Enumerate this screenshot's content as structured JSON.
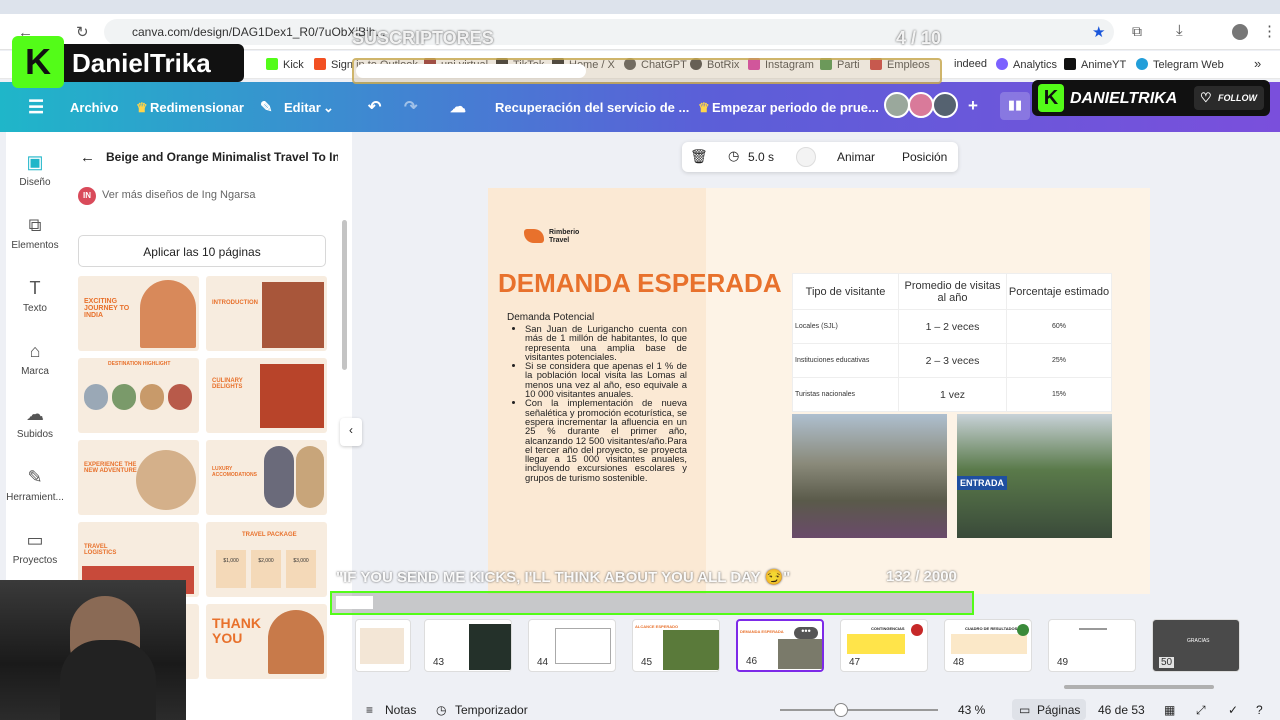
{
  "browser": {
    "url": "canva.com/design/DAG1Dex1_R0/7uObXiBjh...",
    "bookmarks": [
      "Kick",
      "Sign in to Outlook",
      "uni virtual",
      "TikTok",
      "Home / X",
      "ChatGPT",
      "BotRix",
      "Instagram",
      "Parti",
      "Empleos",
      "indeed",
      "Analytics",
      "AnimeYT",
      "Telegram Web"
    ],
    "bookmarks_more": "»"
  },
  "overlay": {
    "brand": "DanielTrika",
    "brand_right": "DANIELTRIKA",
    "follow": "FOLLOW",
    "subs_label": "SUSCRIPTORES",
    "subs_count": "4 / 10",
    "kicks_msg": "\"IF YOU SEND ME KICKS, I'LL THINK ABOUT YOU ALL DAY 😏\"",
    "kicks_count": "132 / 2000",
    "kicks_bar_label": "▮▮▮▮"
  },
  "header": {
    "menu_icon": "hamburger-icon",
    "file": "Archivo",
    "resize": "Redimensionar",
    "edit": "Editar",
    "title": "Recuperación del servicio de ...",
    "trial": "Empezar periodo de prue..."
  },
  "rail": [
    {
      "label": "Diseño",
      "icon": "design-icon"
    },
    {
      "label": "Elementos",
      "icon": "elements-icon"
    },
    {
      "label": "Texto",
      "icon": "text-icon"
    },
    {
      "label": "Marca",
      "icon": "brand-icon"
    },
    {
      "label": "Subidos",
      "icon": "uploads-icon"
    },
    {
      "label": "Herramient...",
      "icon": "tools-icon"
    },
    {
      "label": "Proyectos",
      "icon": "projects-icon"
    }
  ],
  "panel": {
    "title": "Beige and Orange Minimalist Travel To In...",
    "author_initials": "IN",
    "author": "Ver más diseños de Ing Ngarsa",
    "apply": "Aplicar las 10 páginas",
    "thumbs": [
      "EXCITING JOURNEY TO INDIA",
      "INTRODUCTION",
      "DESTINATION HIGHLIGHT",
      "CULINARY DELIGHTS",
      "EXPERIENCE THE NEW ADVENTURE",
      "LUXURY ACCOMODATIONS",
      "TRAVEL LOGISTICS",
      "TRAVEL PACKAGE",
      "",
      "THANK YOU"
    ],
    "package_prices": [
      "$1,000",
      "$2,000",
      "$3,000"
    ]
  },
  "toolbar": {
    "duration": "5.0 s",
    "animate": "Animar",
    "position": "Posición"
  },
  "slide": {
    "logo": "Rimberio Travel",
    "title": "DEMANDA ESPERADA",
    "subtitle": "Demanda Potencial",
    "bullets": [
      "San Juan de Lurigancho cuenta con más de 1 millón de habitantes, lo que representa una amplia base de visitantes potenciales.",
      "Si se considera que apenas el 1 % de la población local visita las Lomas al menos una vez al año, eso equivale a 10 000 visitantes anuales.",
      "Con la implementación de nueva señalética y promoción ecoturística, se espera incrementar la afluencia en un 25 % durante el primer año, alcanzando 12 500 visitantes/año.Para el tercer año del proyecto, se proyecta llegar a 15 000 visitantes anuales, incluyendo excursiones escolares y grupos de turismo sostenible."
    ],
    "table": {
      "headers": [
        "Tipo de visitante",
        "Promedio de visitas al año",
        "Porcentaje estimado"
      ],
      "rows": [
        [
          "Locales (SJL)",
          "1 – 2 veces",
          "60%"
        ],
        [
          "Instituciones educativas",
          "2 – 3 veces",
          "25%"
        ],
        [
          "Turistas nacionales",
          "1 vez",
          "15%"
        ]
      ]
    },
    "photo_sign": "ENTRADA"
  },
  "pages": [
    "43",
    "44",
    "45",
    "46",
    "47",
    "48",
    "49",
    "50"
  ],
  "page_thumb_titles": {
    "45": "ALCANCE ESPERADO",
    "46": "DEMANDA ESPERADA",
    "47": "CONTINGENCIAS",
    "48": "CUADRO DE RESULTADOS",
    "50": "GRACIAS"
  },
  "footer": {
    "notes": "Notas",
    "timer": "Temporizador",
    "zoom": "43 %",
    "pages": "Páginas",
    "page_count": "46 de 53"
  },
  "colors": {
    "accent": "#e8712c",
    "purple": "#7d2ae8",
    "teal": "#1fb6c9",
    "kick_green": "#53fc18"
  }
}
